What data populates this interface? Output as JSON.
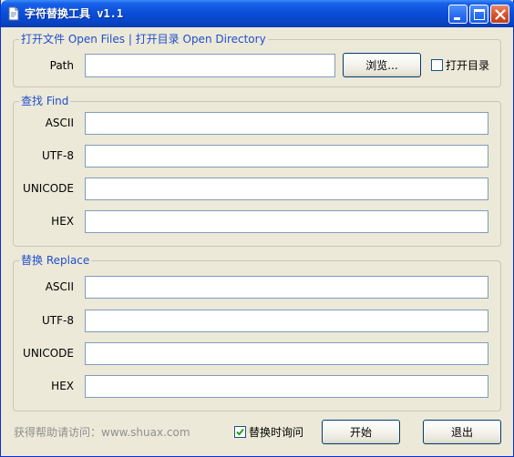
{
  "window": {
    "title": "字符替换工具 v1.1",
    "icons": {
      "app": "document-icon",
      "minimize": "minimize-icon",
      "maximize": "maximize-icon",
      "close": "close-icon"
    },
    "colors": {
      "titlebar": "#0845c8",
      "legend": "#1f4ecc",
      "face": "#ece9d8"
    }
  },
  "open_group": {
    "legend": "打开文件 Open Files | 打开目录 Open Directory",
    "path_label": "Path",
    "path_value": "",
    "browse_label": "浏览...",
    "open_dir_label": "打开目录",
    "open_dir_checked": false
  },
  "find_group": {
    "legend": "查找 Find",
    "rows": [
      {
        "label": "ASCII",
        "value": ""
      },
      {
        "label": "UTF-8",
        "value": ""
      },
      {
        "label": "UNICODE",
        "value": ""
      },
      {
        "label": "HEX",
        "value": ""
      }
    ]
  },
  "replace_group": {
    "legend": "替换 Replace",
    "rows": [
      {
        "label": "ASCII",
        "value": ""
      },
      {
        "label": "UTF-8",
        "value": ""
      },
      {
        "label": "UNICODE",
        "value": ""
      },
      {
        "label": "HEX",
        "value": ""
      }
    ]
  },
  "footer": {
    "help_text": "获得帮助请访问：www.shuax.com",
    "ask_replace_label": "替换时询问",
    "ask_replace_checked": true,
    "start_label": "开始",
    "exit_label": "退出"
  }
}
